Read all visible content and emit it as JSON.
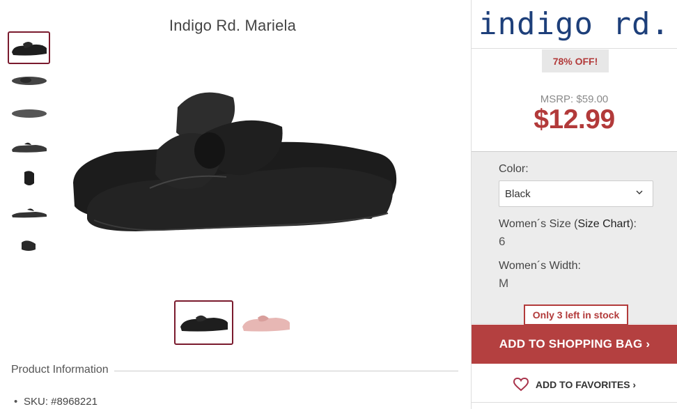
{
  "product": {
    "title": "Indigo Rd. Mariela",
    "thumbnails": [
      "shoe-side-view",
      "shoe-top-view",
      "shoe-sole-view",
      "shoe-side-view-2",
      "shoe-back-view",
      "shoe-pair-view",
      "shoe-heel-view"
    ],
    "color_swatches": [
      "Black",
      "Pink"
    ],
    "section_title": "Product Information",
    "sku": "SKU: #8968221"
  },
  "brand": {
    "logo_text": "indigo rd."
  },
  "pricing": {
    "discount": "78% OFF!",
    "msrp": "MSRP: $59.00",
    "price": "$12.99"
  },
  "options": {
    "color_label": "Color:",
    "color_value": "Black",
    "size_label_prefix": "Women´s Size (",
    "size_chart_link": "Size Chart",
    "size_label_suffix": "):",
    "size_value": "6",
    "width_label": "Women´s Width:",
    "width_value": "M",
    "stock_prefix": "Only",
    "stock_count": "3",
    "stock_suffix": "left in stock"
  },
  "actions": {
    "add_to_bag": "ADD TO SHOPPING BAG ›",
    "add_to_favorites": "ADD TO FAVORITES ›"
  },
  "colors": {
    "accent": "#b23a3a",
    "brand_blue": "#1d3f7a",
    "selected_border": "#7a1a2d"
  }
}
